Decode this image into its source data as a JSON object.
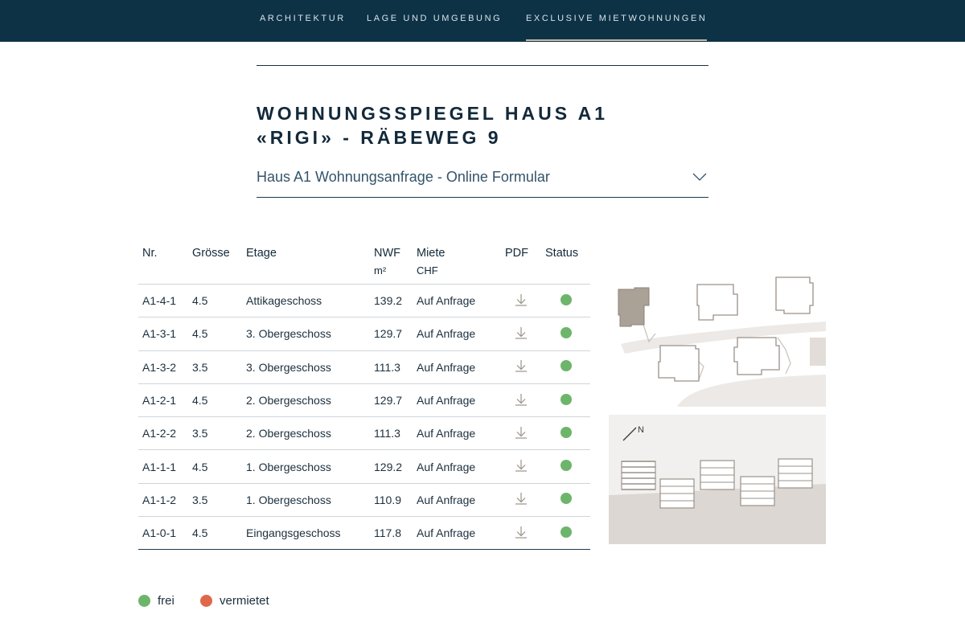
{
  "nav": {
    "items": [
      {
        "label": "ARCHITEKTUR"
      },
      {
        "label": "LAGE UND UMGEBUNG"
      },
      {
        "label": "EXCLUSIVE MIETWOHNUNGEN"
      }
    ]
  },
  "page": {
    "title_line1": "WOHNUNGSSPIEGEL HAUS A1",
    "title_line2": "«RIGI» - RÄBEWEG 9",
    "dropdown_label": "Haus A1 Wohnungsanfrage - Online Formular"
  },
  "table": {
    "headers": {
      "nr": "Nr.",
      "groesse": "Grösse",
      "etage": "Etage",
      "nwf": "NWF",
      "nwf_unit": "m²",
      "miete": "Miete",
      "miete_unit": "CHF",
      "pdf": "PDF",
      "status": "Status"
    },
    "rows": [
      {
        "nr": "A1-4-1",
        "groesse": "4.5",
        "etage": "Attikageschoss",
        "nwf": "139.2",
        "miete": "Auf Anfrage",
        "status": "frei"
      },
      {
        "nr": "A1-3-1",
        "groesse": "4.5",
        "etage": "3. Obergeschoss",
        "nwf": "129.7",
        "miete": "Auf Anfrage",
        "status": "frei"
      },
      {
        "nr": "A1-3-2",
        "groesse": "3.5",
        "etage": "3. Obergeschoss",
        "nwf": "111.3",
        "miete": "Auf Anfrage",
        "status": "frei"
      },
      {
        "nr": "A1-2-1",
        "groesse": "4.5",
        "etage": "2. Obergeschoss",
        "nwf": "129.7",
        "miete": "Auf Anfrage",
        "status": "frei"
      },
      {
        "nr": "A1-2-2",
        "groesse": "3.5",
        "etage": "2. Obergeschoss",
        "nwf": "111.3",
        "miete": "Auf Anfrage",
        "status": "frei"
      },
      {
        "nr": "A1-1-1",
        "groesse": "4.5",
        "etage": "1. Obergeschoss",
        "nwf": "129.2",
        "miete": "Auf Anfrage",
        "status": "frei"
      },
      {
        "nr": "A1-1-2",
        "groesse": "3.5",
        "etage": "1. Obergeschoss",
        "nwf": "110.9",
        "miete": "Auf Anfrage",
        "status": "frei"
      },
      {
        "nr": "A1-0-1",
        "groesse": "4.5",
        "etage": "Eingangsgeschoss",
        "nwf": "117.8",
        "miete": "Auf Anfrage",
        "status": "frei"
      }
    ]
  },
  "legend": [
    {
      "label": "frei",
      "color": "#6db56b"
    },
    {
      "label": "vermietet",
      "color": "#e0684a"
    }
  ],
  "colors": {
    "nav_bg": "#0d3246",
    "status_free": "#6db56b",
    "status_rented": "#e0684a",
    "accent_underline": "#c8b8a8"
  },
  "icons": {
    "dropdown": "chevron-down-icon",
    "pdf": "download-icon",
    "compass": "north-arrow-icon"
  }
}
